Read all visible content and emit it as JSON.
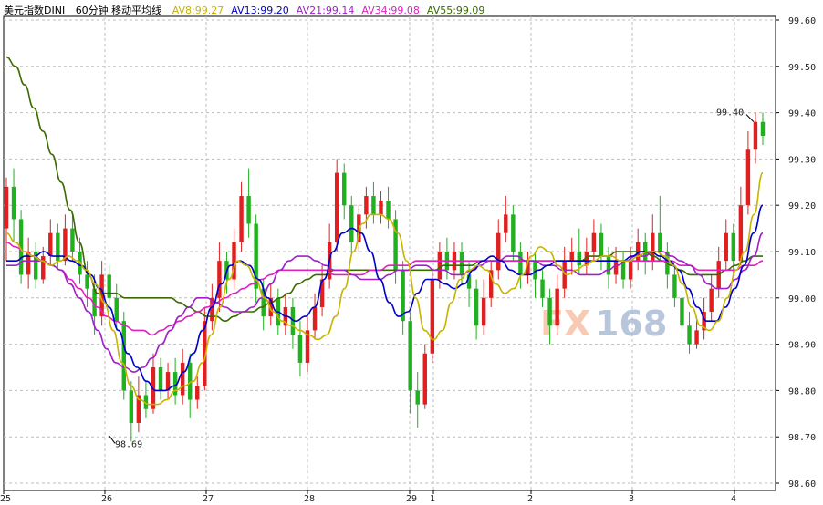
{
  "title": "美元指数DINI",
  "subtitle": "60分钟 移动平均线",
  "watermark": {
    "text_fx": "FX",
    "text_num": "168"
  },
  "chart_data": {
    "type": "candlestick",
    "ylim": [
      98.6,
      99.6
    ],
    "y_ticks": [
      "99.60",
      "99.50",
      "99.40",
      "99.30",
      "99.20",
      "99.10",
      "99.00",
      "98.90",
      "98.80",
      "98.70",
      "98.60"
    ],
    "x_ticks": [
      "25",
      "26",
      "27",
      "28",
      "29",
      "1",
      "2",
      "3",
      "4"
    ],
    "legend": [
      {
        "label": "AV8:",
        "value": "99.27",
        "color": "#c8b400"
      },
      {
        "label": "AV13:",
        "value": "99.20",
        "color": "#0000c8"
      },
      {
        "label": "AV21:",
        "value": "99.14",
        "color": "#a020c8"
      },
      {
        "label": "AV34:",
        "value": "99.08",
        "color": "#e020c0"
      },
      {
        "label": "AV55:",
        "value": "99.09",
        "color": "#3a6a00"
      }
    ],
    "annotations": [
      {
        "text": "99.40",
        "value": 99.4
      },
      {
        "text": "98.69",
        "value": 98.69
      }
    ],
    "candles": [
      [
        99.15,
        99.24,
        99.26,
        99.08
      ],
      [
        99.24,
        99.17,
        99.28,
        99.12
      ],
      [
        99.17,
        99.05,
        99.19,
        99.03
      ],
      [
        99.05,
        99.1,
        99.13,
        99.02
      ],
      [
        99.1,
        99.04,
        99.12,
        99.02
      ],
      [
        99.04,
        99.09,
        99.11,
        99.03
      ],
      [
        99.09,
        99.14,
        99.17,
        99.07
      ],
      [
        99.14,
        99.08,
        99.16,
        99.06
      ],
      [
        99.08,
        99.15,
        99.18,
        99.07
      ],
      [
        99.15,
        99.1,
        99.18,
        99.08
      ],
      [
        99.1,
        99.05,
        99.13,
        99.03
      ],
      [
        99.05,
        99.02,
        99.08,
        98.98
      ],
      [
        99.02,
        98.96,
        99.05,
        98.92
      ],
      [
        98.96,
        99.05,
        99.08,
        98.94
      ],
      [
        99.05,
        99.0,
        99.07,
        98.97
      ],
      [
        99.0,
        98.95,
        99.03,
        98.93
      ],
      [
        98.95,
        98.8,
        98.97,
        98.78
      ],
      [
        98.8,
        98.73,
        98.82,
        98.69
      ],
      [
        98.73,
        98.79,
        98.83,
        98.71
      ],
      [
        98.79,
        98.76,
        98.82,
        98.74
      ],
      [
        98.76,
        98.85,
        98.88,
        98.75
      ],
      [
        98.85,
        98.8,
        98.87,
        98.78
      ],
      [
        98.8,
        98.84,
        98.86,
        98.78
      ],
      [
        98.84,
        98.79,
        98.87,
        98.77
      ],
      [
        98.79,
        98.86,
        98.89,
        98.77
      ],
      [
        98.86,
        98.78,
        98.88,
        98.74
      ],
      [
        98.78,
        98.81,
        98.83,
        98.76
      ],
      [
        98.81,
        98.95,
        98.98,
        98.8
      ],
      [
        98.95,
        99.0,
        99.03,
        98.93
      ],
      [
        99.0,
        99.08,
        99.12,
        98.97
      ],
      [
        99.08,
        99.04,
        99.1,
        99.01
      ],
      [
        99.04,
        99.12,
        99.15,
        99.02
      ],
      [
        99.12,
        99.22,
        99.25,
        99.1
      ],
      [
        99.22,
        99.16,
        99.28,
        99.13
      ],
      [
        99.16,
        99.02,
        99.18,
        98.99
      ],
      [
        99.02,
        98.96,
        99.04,
        98.93
      ],
      [
        98.96,
        99.0,
        99.03,
        98.94
      ],
      [
        99.0,
        98.94,
        99.02,
        98.92
      ],
      [
        98.94,
        98.98,
        99.01,
        98.92
      ],
      [
        98.98,
        98.92,
        99.0,
        98.89
      ],
      [
        98.92,
        98.86,
        98.95,
        98.83
      ],
      [
        98.86,
        98.93,
        98.96,
        98.84
      ],
      [
        98.93,
        98.98,
        99.01,
        98.91
      ],
      [
        98.98,
        99.04,
        99.07,
        98.96
      ],
      [
        99.04,
        99.12,
        99.16,
        99.02
      ],
      [
        99.12,
        99.27,
        99.3,
        99.1
      ],
      [
        99.27,
        99.2,
        99.29,
        99.17
      ],
      [
        99.2,
        99.12,
        99.22,
        99.09
      ],
      [
        99.12,
        99.18,
        99.2,
        99.1
      ],
      [
        99.18,
        99.22,
        99.24,
        99.15
      ],
      [
        99.22,
        99.18,
        99.25,
        99.16
      ],
      [
        99.18,
        99.21,
        99.23,
        99.16
      ],
      [
        99.21,
        99.17,
        99.24,
        99.15
      ],
      [
        99.17,
        99.06,
        99.19,
        99.03
      ],
      [
        99.06,
        98.95,
        99.08,
        98.92
      ],
      [
        98.95,
        98.8,
        98.97,
        98.75
      ],
      [
        98.8,
        98.77,
        98.84,
        98.72
      ],
      [
        98.77,
        98.88,
        98.9,
        98.76
      ],
      [
        98.88,
        99.04,
        99.06,
        98.86
      ],
      [
        99.04,
        99.1,
        99.12,
        99.02
      ],
      [
        99.1,
        99.06,
        99.13,
        99.04
      ],
      [
        99.06,
        99.1,
        99.12,
        99.04
      ],
      [
        99.1,
        99.05,
        99.12,
        99.03
      ],
      [
        99.05,
        99.02,
        99.08,
        98.98
      ],
      [
        99.02,
        98.94,
        99.04,
        98.91
      ],
      [
        98.94,
        99.0,
        99.04,
        98.92
      ],
      [
        99.0,
        99.06,
        99.08,
        98.98
      ],
      [
        99.06,
        99.14,
        99.17,
        99.04
      ],
      [
        99.14,
        99.18,
        99.22,
        99.12
      ],
      [
        99.18,
        99.1,
        99.2,
        99.08
      ],
      [
        99.1,
        99.05,
        99.12,
        99.02
      ],
      [
        99.05,
        99.08,
        99.1,
        99.03
      ],
      [
        99.08,
        99.04,
        99.1,
        99.0
      ],
      [
        99.04,
        99.0,
        99.06,
        98.98
      ],
      [
        99.0,
        98.94,
        99.02,
        98.9
      ],
      [
        98.94,
        99.02,
        99.05,
        98.92
      ],
      [
        99.02,
        99.08,
        99.11,
        99.0
      ],
      [
        99.08,
        99.1,
        99.13,
        99.05
      ],
      [
        99.1,
        99.07,
        99.15,
        99.05
      ],
      [
        99.07,
        99.1,
        99.13,
        99.05
      ],
      [
        99.1,
        99.14,
        99.17,
        99.08
      ],
      [
        99.14,
        99.09,
        99.16,
        99.06
      ],
      [
        99.09,
        99.05,
        99.11,
        99.02
      ],
      [
        99.05,
        99.08,
        99.11,
        99.03
      ],
      [
        99.08,
        99.04,
        99.1,
        99.02
      ],
      [
        99.04,
        99.08,
        99.11,
        99.02
      ],
      [
        99.08,
        99.12,
        99.15,
        99.06
      ],
      [
        99.12,
        99.08,
        99.14,
        99.05
      ],
      [
        99.08,
        99.14,
        99.18,
        99.06
      ],
      [
        99.14,
        99.1,
        99.22,
        99.08
      ],
      [
        99.1,
        99.05,
        99.12,
        99.02
      ],
      [
        99.05,
        99.0,
        99.07,
        98.98
      ],
      [
        99.0,
        98.94,
        99.03,
        98.91
      ],
      [
        98.94,
        98.9,
        98.97,
        98.88
      ],
      [
        98.9,
        98.93,
        98.96,
        98.89
      ],
      [
        98.93,
        98.97,
        99.0,
        98.91
      ],
      [
        98.97,
        99.02,
        99.05,
        98.95
      ],
      [
        99.02,
        99.08,
        99.11,
        99.0
      ],
      [
        99.08,
        99.14,
        99.17,
        99.06
      ],
      [
        99.14,
        99.08,
        99.16,
        99.05
      ],
      [
        99.08,
        99.2,
        99.24,
        99.07
      ],
      [
        99.2,
        99.32,
        99.36,
        99.18
      ],
      [
        99.32,
        99.38,
        99.4,
        99.29
      ],
      [
        99.38,
        99.35,
        99.4,
        99.33
      ]
    ],
    "ma8": [
      99.14,
      99.12,
      99.1,
      99.09,
      99.08,
      99.07,
      99.08,
      99.09,
      99.08,
      99.06,
      99.03,
      98.99,
      98.93,
      98.86,
      98.81,
      98.78,
      98.77,
      98.77,
      98.78,
      98.8,
      98.81,
      98.82,
      98.86,
      98.92,
      98.98,
      99.04,
      99.08,
      99.07,
      99.04,
      99.0,
      98.97,
      98.95,
      98.94,
      98.93,
      98.92,
      98.91,
      98.92,
      98.96,
      99.02,
      99.1,
      99.16,
      99.18,
      99.18,
      99.17,
      99.14,
      99.08,
      99.0,
      98.93,
      98.91,
      98.93,
      98.99,
      99.04,
      99.06,
      99.07,
      99.06,
      99.03,
      99.01,
      99.02,
      99.05,
      99.09,
      99.11,
      99.1,
      99.07,
      99.05,
      99.06,
      99.07,
      99.08,
      99.09,
      99.09,
      99.08,
      99.08,
      99.09,
      99.1,
      99.1,
      99.09,
      99.07,
      99.03,
      98.98,
      98.94,
      98.93,
      98.95,
      99.0,
      99.06,
      99.1,
      99.18,
      99.27
    ],
    "ma13": [
      99.08,
      99.08,
      99.09,
      99.09,
      99.1,
      99.09,
      99.09,
      99.08,
      99.07,
      99.05,
      99.02,
      98.98,
      98.93,
      98.88,
      98.85,
      98.82,
      98.8,
      98.8,
      98.81,
      98.84,
      98.88,
      98.93,
      98.98,
      99.03,
      99.07,
      99.08,
      99.07,
      99.04,
      99.0,
      98.97,
      98.96,
      98.95,
      98.96,
      98.98,
      99.04,
      99.1,
      99.14,
      99.15,
      99.14,
      99.1,
      99.04,
      98.99,
      98.96,
      98.97,
      99.01,
      99.04,
      99.04,
      99.03,
      99.02,
      99.03,
      99.06,
      99.08,
      99.09,
      99.08,
      99.06,
      99.05,
      99.05,
      99.06,
      99.07,
      99.08,
      99.08,
      99.08,
      99.08,
      99.08,
      99.08,
      99.08,
      99.08,
      99.09,
      99.1,
      99.1,
      99.09,
      99.08,
      99.06,
      99.02,
      98.98,
      98.95,
      98.95,
      98.98,
      99.02,
      99.07,
      99.14,
      99.2
    ],
    "ma21": [
      99.07,
      99.07,
      99.08,
      99.08,
      99.08,
      99.07,
      99.06,
      99.03,
      99.0,
      98.97,
      98.93,
      98.89,
      98.86,
      98.85,
      98.84,
      98.85,
      98.87,
      98.9,
      98.93,
      98.96,
      98.98,
      99.0,
      99.0,
      98.99,
      98.98,
      98.97,
      98.97,
      98.98,
      99.0,
      99.03,
      99.06,
      99.08,
      99.09,
      99.09,
      99.08,
      99.07,
      99.06,
      99.06,
      99.05,
      99.04,
      99.04,
      99.04,
      99.05,
      99.06,
      99.06,
      99.07,
      99.07,
      99.06,
      99.06,
      99.05,
      99.05,
      99.06,
      99.07,
      99.08,
      99.08,
      99.09,
      99.09,
      99.08,
      99.08,
      99.07,
      99.07,
      99.06,
      99.06,
      99.05,
      99.05,
      99.05,
      99.06,
      99.07,
      99.08,
      99.09,
      99.09,
      99.1,
      99.1,
      99.09,
      99.08,
      99.07,
      99.05,
      99.03,
      99.02,
      99.02,
      99.04,
      99.06,
      99.09,
      99.14
    ],
    "ma34": [
      99.12,
      99.11,
      99.1,
      99.09,
      99.08,
      99.07,
      99.06,
      99.04,
      99.02,
      99.0,
      98.98,
      98.96,
      98.95,
      98.94,
      98.93,
      98.93,
      98.92,
      98.93,
      98.94,
      98.95,
      98.96,
      98.97,
      98.98,
      98.99,
      99.0,
      99.01,
      99.02,
      99.03,
      99.04,
      99.05,
      99.06,
      99.06,
      99.06,
      99.06,
      99.06,
      99.06,
      99.05,
      99.05,
      99.05,
      99.05,
      99.06,
      99.06,
      99.07,
      99.07,
      99.07,
      99.08,
      99.08,
      99.08,
      99.08,
      99.08,
      99.08,
      99.08,
      99.08,
      99.08,
      99.08,
      99.08,
      99.08,
      99.08,
      99.08,
      99.08,
      99.08,
      99.08,
      99.08,
      99.08,
      99.08,
      99.08,
      99.08,
      99.08,
      99.08,
      99.08,
      99.08,
      99.08,
      99.08,
      99.08,
      99.07,
      99.07,
      99.06,
      99.06,
      99.06,
      99.06,
      99.06,
      99.07,
      99.07,
      99.08
    ],
    "ma55": [
      99.52,
      99.5,
      99.46,
      99.41,
      99.36,
      99.31,
      99.25,
      99.19,
      99.12,
      99.05,
      99.01,
      99.01,
      99.01,
      99.0,
      99.0,
      99.0,
      99.0,
      99.0,
      99.0,
      98.99,
      98.98,
      98.97,
      98.96,
      98.96,
      98.95,
      98.96,
      98.97,
      98.97,
      98.98,
      98.99,
      99.0,
      99.01,
      99.03,
      99.04,
      99.05,
      99.05,
      99.06,
      99.06,
      99.06,
      99.06,
      99.06,
      99.06,
      99.06,
      99.06,
      99.06,
      99.06,
      99.06,
      99.06,
      99.07,
      99.07,
      99.07,
      99.07,
      99.08,
      99.08,
      99.08,
      99.08,
      99.08,
      99.08,
      99.08,
      99.08,
      99.08,
      99.08,
      99.08,
      99.08,
      99.09,
      99.09,
      99.09,
      99.1,
      99.1,
      99.1,
      99.1,
      99.09,
      99.08,
      99.07,
      99.06,
      99.05,
      99.05,
      99.05,
      99.05,
      99.06,
      99.07,
      99.08,
      99.09,
      99.09
    ]
  }
}
